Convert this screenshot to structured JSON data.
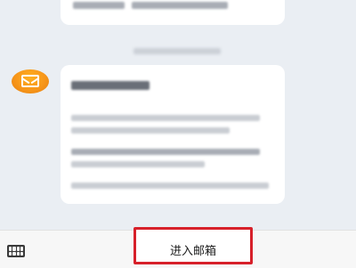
{
  "bottom_bar": {
    "enter_mailbox_label": "进入邮箱",
    "highlight_color": "#d7202a",
    "left_icon": "keyboard-icon"
  },
  "chat": {
    "sender_icon": "mail-icon",
    "sender_icon_color": "#f7961a"
  }
}
